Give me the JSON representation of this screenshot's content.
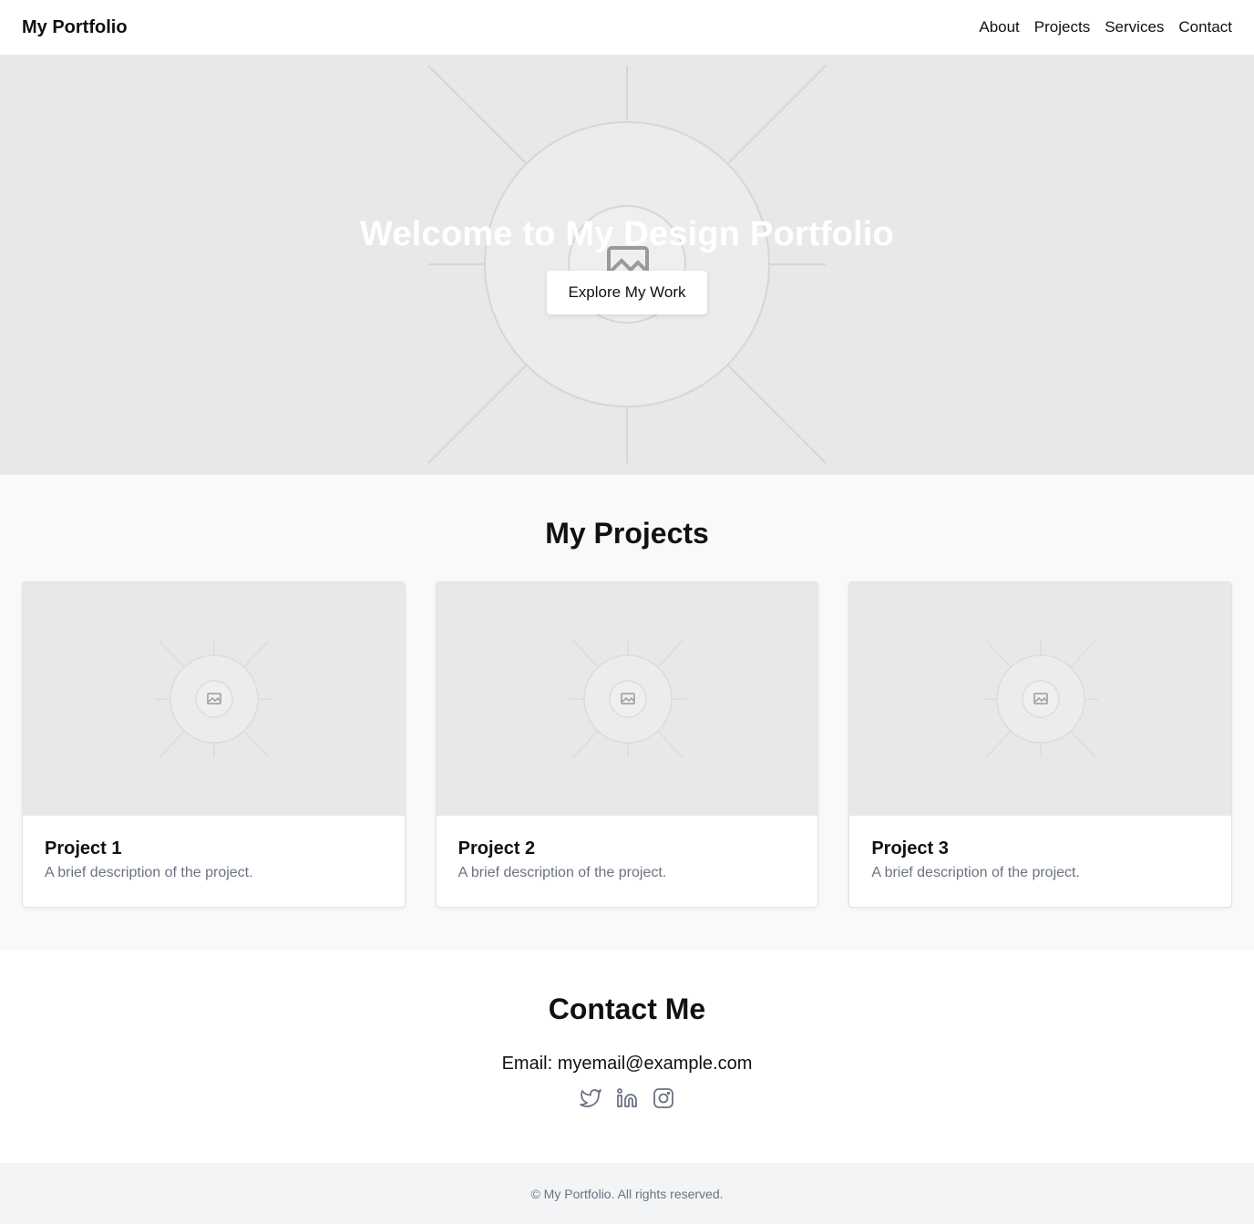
{
  "header": {
    "brand": "My Portfolio",
    "nav": [
      "About",
      "Projects",
      "Services",
      "Contact"
    ]
  },
  "hero": {
    "title": "Welcome to My Design Portfolio",
    "cta_label": "Explore My Work",
    "image_icon": "image-placeholder-icon"
  },
  "projects": {
    "heading": "My Projects",
    "items": [
      {
        "title": "Project 1",
        "description": "A brief description of the project."
      },
      {
        "title": "Project 2",
        "description": "A brief description of the project."
      },
      {
        "title": "Project 3",
        "description": "A brief description of the project."
      }
    ]
  },
  "contact": {
    "heading": "Contact Me",
    "email": "Email: myemail@example.com",
    "socials": [
      "twitter-icon",
      "linkedin-icon",
      "instagram-icon"
    ]
  },
  "footer": {
    "text": "© My Portfolio. All rights reserved."
  },
  "colors": {
    "hero_bg": "#e8e8e8",
    "section_bg": "#f8f9fa",
    "footer_bg": "#f3f4f6",
    "muted_text": "#6b7280",
    "icon_gray": "#6b7280"
  }
}
